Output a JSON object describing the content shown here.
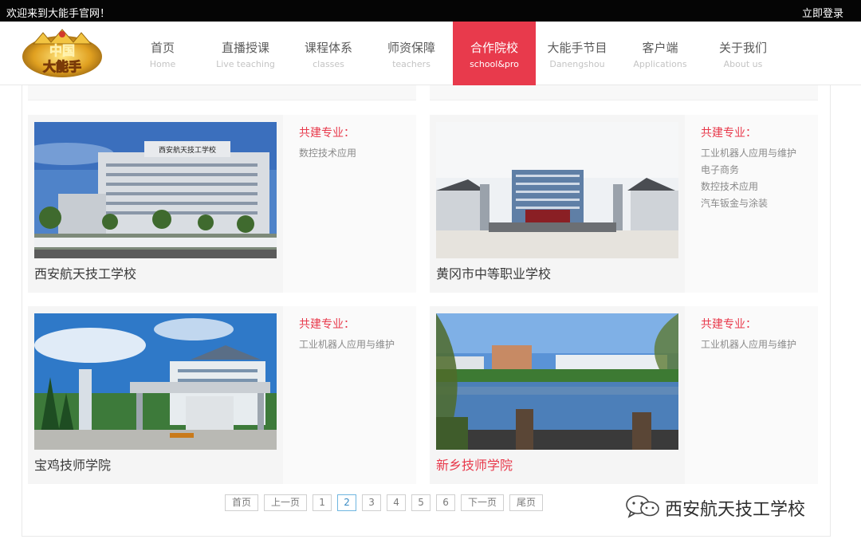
{
  "topbar": {
    "welcome": "欢迎来到大能手官网！",
    "login": "立即登录"
  },
  "logo": {
    "line1": "中国",
    "line2": "大能手"
  },
  "nav": [
    {
      "cn": "首页",
      "en": "Home"
    },
    {
      "cn": "直播授课",
      "en": "Live teaching"
    },
    {
      "cn": "课程体系",
      "en": "classes"
    },
    {
      "cn": "师资保障",
      "en": "teachers"
    },
    {
      "cn": "合作院校",
      "en": "school&pro"
    },
    {
      "cn": "大能手节目",
      "en": "Danengshou"
    },
    {
      "cn": "客户端",
      "en": "Applications"
    },
    {
      "cn": "关于我们",
      "en": "About us"
    }
  ],
  "cards": [
    {
      "name": "西安航天技工学校",
      "majors_title": "共建专业：",
      "majors": [
        "数控技术应用"
      ]
    },
    {
      "name": "黄冈市中等职业学校",
      "majors_title": "共建专业：",
      "majors": [
        "工业机器人应用与维护",
        "电子商务",
        "数控技术应用",
        "汽车钣金与涂装"
      ]
    },
    {
      "name": "宝鸡技师学院",
      "majors_title": "共建专业：",
      "majors": [
        "工业机器人应用与维护"
      ]
    },
    {
      "name": "新乡技师学院",
      "majors_title": "共建专业：",
      "majors": [
        "工业机器人应用与维护"
      ]
    }
  ],
  "photo_text": {
    "building_sign": "西安航天技工学校"
  },
  "pager": {
    "first": "首页",
    "prev": "上一页",
    "pages": [
      "1",
      "2",
      "3",
      "4",
      "5",
      "6"
    ],
    "next": "下一页",
    "last": "尾页",
    "current": "2"
  },
  "watermark": {
    "text": "西安航天技工学校"
  },
  "colors": {
    "accent": "#e83a4c",
    "topbar": "#050505",
    "pager_active": "#3b8cc4"
  }
}
